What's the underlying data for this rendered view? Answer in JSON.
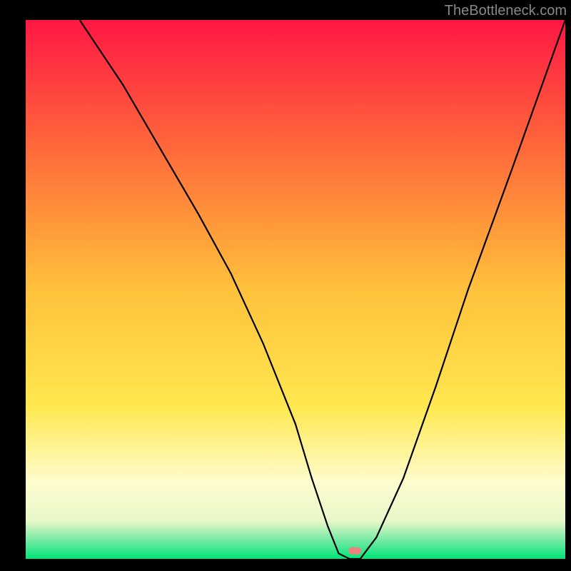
{
  "watermark": "TheBottleneck.com",
  "chart_data": {
    "type": "line",
    "title": "",
    "xlabel": "",
    "ylabel": "",
    "xlim": [
      0,
      100
    ],
    "ylim": [
      0,
      100
    ],
    "gradient_stops": [
      {
        "offset": 0,
        "color": "#ff1744"
      },
      {
        "offset": 25,
        "color": "#ff6d3a"
      },
      {
        "offset": 50,
        "color": "#ffc13b"
      },
      {
        "offset": 72,
        "color": "#ffe850"
      },
      {
        "offset": 86,
        "color": "#fdfccf"
      },
      {
        "offset": 93,
        "color": "#e8f8c8"
      },
      {
        "offset": 97,
        "color": "#66e8a0"
      },
      {
        "offset": 100,
        "color": "#00e676"
      }
    ],
    "series": [
      {
        "name": "bottleneck-curve",
        "x": [
          10,
          18,
          25,
          32,
          38,
          44,
          50,
          53,
          56,
          58,
          60,
          62,
          65,
          70,
          76,
          82,
          90,
          100
        ],
        "y": [
          100,
          88,
          76,
          64,
          53,
          40,
          25,
          15,
          6,
          1,
          0,
          0,
          4,
          15,
          32,
          50,
          72,
          100
        ]
      }
    ],
    "marker": {
      "x": 61,
      "y": 1.5,
      "color": "#f08080",
      "label": "optimal-point"
    }
  }
}
